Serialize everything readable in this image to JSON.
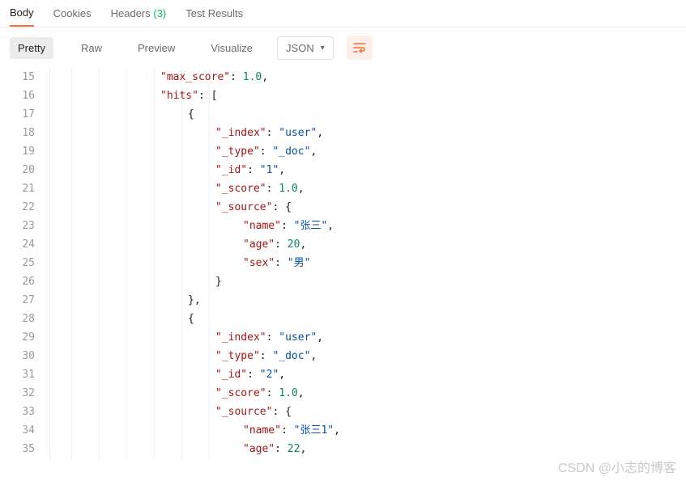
{
  "tabs": {
    "body": "Body",
    "cookies": "Cookies",
    "headers": "Headers",
    "headers_count": "(3)",
    "test_results": "Test Results"
  },
  "toolbar": {
    "pretty": "Pretty",
    "raw": "Raw",
    "preview": "Preview",
    "visualize": "Visualize",
    "format_label": "JSON"
  },
  "lines": {
    "start": 15,
    "end": 35
  },
  "code": {
    "l15": {
      "k": "\"max_score\"",
      "n": "1.0"
    },
    "l16": {
      "k": "\"hits\"",
      "p": "["
    },
    "l18": {
      "k": "\"_index\"",
      "s": "\"user\""
    },
    "l19": {
      "k": "\"_type\"",
      "s": "\"_doc\""
    },
    "l20": {
      "k": "\"_id\"",
      "s": "\"1\""
    },
    "l21": {
      "k": "\"_score\"",
      "n": "1.0"
    },
    "l22": {
      "k": "\"_source\"",
      "p": "{"
    },
    "l23": {
      "k": "\"name\"",
      "s": "\"张三\""
    },
    "l24": {
      "k": "\"age\"",
      "n": "20"
    },
    "l25": {
      "k": "\"sex\"",
      "s": "\"男\""
    },
    "l29": {
      "k": "\"_index\"",
      "s": "\"user\""
    },
    "l30": {
      "k": "\"_type\"",
      "s": "\"_doc\""
    },
    "l31": {
      "k": "\"_id\"",
      "s": "\"2\""
    },
    "l32": {
      "k": "\"_score\"",
      "n": "1.0"
    },
    "l33": {
      "k": "\"_source\"",
      "p": "{"
    },
    "l34": {
      "k": "\"name\"",
      "s": "\"张三1\""
    },
    "l35": {
      "k": "\"age\"",
      "n": "22"
    }
  },
  "braces": {
    "open": "{",
    "close": "}",
    "close_comma": "},",
    "comma": ","
  },
  "punct": {
    "colon_sp": ": "
  },
  "watermark": "CSDN @小志的博客",
  "guides": [
    26,
    60,
    94,
    128,
    162,
    196
  ]
}
